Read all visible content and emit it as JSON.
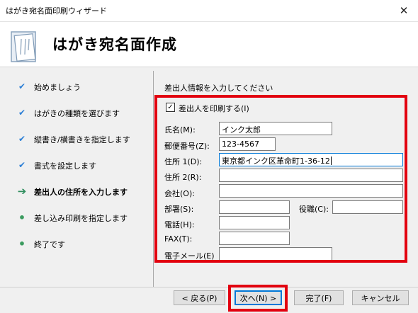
{
  "window": {
    "title": "はがき宛名面印刷ウィザード",
    "close_glyph": "✕"
  },
  "banner": {
    "title": "はがき宛名面作成",
    "icon": "postcard-wizard-icon"
  },
  "steps": [
    {
      "label": "始めましょう",
      "state": "done",
      "glyph": "✔"
    },
    {
      "label": "はがきの種類を選びます",
      "state": "done",
      "glyph": "✔"
    },
    {
      "label": "縦書き/横書きを指定します",
      "state": "done",
      "glyph": "✔"
    },
    {
      "label": "書式を設定します",
      "state": "done",
      "glyph": "✔"
    },
    {
      "label": "差出人の住所を入力します",
      "state": "current",
      "glyph": "➔"
    },
    {
      "label": "差し込み印刷を指定します",
      "state": "pending",
      "glyph": "•"
    },
    {
      "label": "終了です",
      "state": "pending",
      "glyph": "•"
    }
  ],
  "form": {
    "heading": "差出人情報を入力してください",
    "print_sender": {
      "label": "差出人を印刷する(I)",
      "checked": true,
      "glyph": "✓"
    },
    "fields": {
      "name": {
        "label": "氏名(M):",
        "value": "インク太郎"
      },
      "postal": {
        "label": "郵便番号(Z):",
        "value": "123-4567"
      },
      "address1": {
        "label": "住所 1(D):",
        "value": "東京都インク区革命町1-36-12"
      },
      "address2": {
        "label": "住所 2(R):",
        "value": ""
      },
      "company": {
        "label": "会社(O):",
        "value": ""
      },
      "department": {
        "label": "部署(S):",
        "value": ""
      },
      "title": {
        "label": "役職(C):",
        "value": ""
      },
      "phone": {
        "label": "電話(H):",
        "value": ""
      },
      "fax": {
        "label": "FAX(T):",
        "value": ""
      },
      "email": {
        "label": "電子メール(E)",
        "value": ""
      }
    }
  },
  "buttons": {
    "back": "< 戻る(P)",
    "next": "次へ(N) >",
    "finish": "完了(F)",
    "cancel": "キャンセル"
  },
  "colors": {
    "highlight": "#e2000f",
    "focus": "#0078d7"
  }
}
